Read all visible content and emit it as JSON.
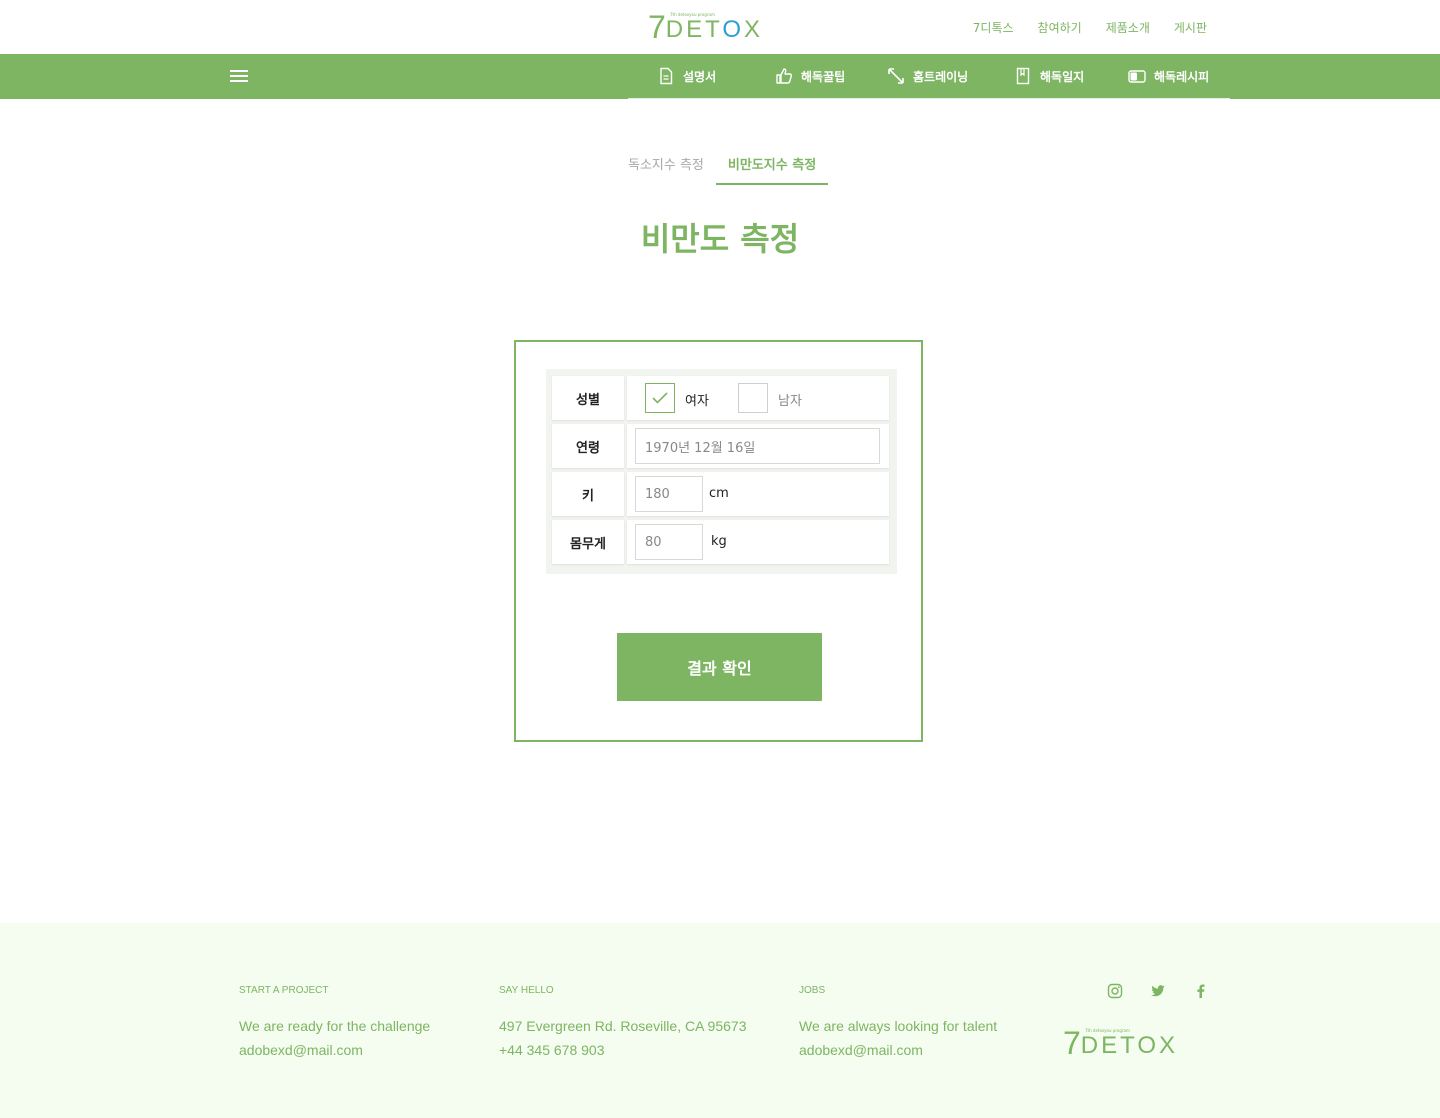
{
  "header": {
    "logo": {
      "seven": "7",
      "word_part1": "DET",
      "word_o": "O",
      "word_part2": "X",
      "tagline": "7th detoxyou program"
    },
    "top_nav": [
      "7디톡스",
      "참여하기",
      "제품소개",
      "게시판"
    ]
  },
  "navbar": {
    "items": [
      {
        "label": "설명서",
        "icon": "document-icon"
      },
      {
        "label": "해독꿀팁",
        "icon": "thumbs-up-icon"
      },
      {
        "label": "홈트레이닝",
        "icon": "expand-arrows-icon"
      },
      {
        "label": "해독일지",
        "icon": "notebook-icon"
      },
      {
        "label": "해독레시피",
        "icon": "toggle-icon"
      }
    ]
  },
  "tabs": [
    {
      "label": "독소지수 측정",
      "active": false
    },
    {
      "label": "비만도지수 측정",
      "active": true
    }
  ],
  "page_title": "비만도 측정",
  "form": {
    "gender": {
      "label": "성별",
      "options": [
        {
          "label": "여자",
          "checked": true
        },
        {
          "label": "남자",
          "checked": false
        }
      ]
    },
    "age": {
      "label": "연령",
      "value": "1970년 12월 16일"
    },
    "height": {
      "label": "키",
      "value": "180",
      "unit": "cm"
    },
    "weight": {
      "label": "몸무게",
      "value": "80",
      "unit": "kg"
    },
    "submit_label": "결과 확인"
  },
  "footer": {
    "columns": [
      {
        "heading": "START A PROJECT",
        "lines": [
          "We are ready for the challenge",
          "adobexd@mail.com"
        ]
      },
      {
        "heading": "SAY HELLO",
        "lines": [
          "497 Evergreen Rd. Roseville, CA 95673",
          "+44 345 678 903"
        ]
      },
      {
        "heading": "JOBS",
        "lines": [
          "We are always looking for talent",
          "adobexd@mail.com"
        ]
      }
    ],
    "socials": [
      "instagram-icon",
      "twitter-icon",
      "facebook-icon"
    ]
  },
  "colors": {
    "accent": "#7db562",
    "logo_o": "#2d9fd6",
    "footer_bg": "#f5fdf1"
  }
}
